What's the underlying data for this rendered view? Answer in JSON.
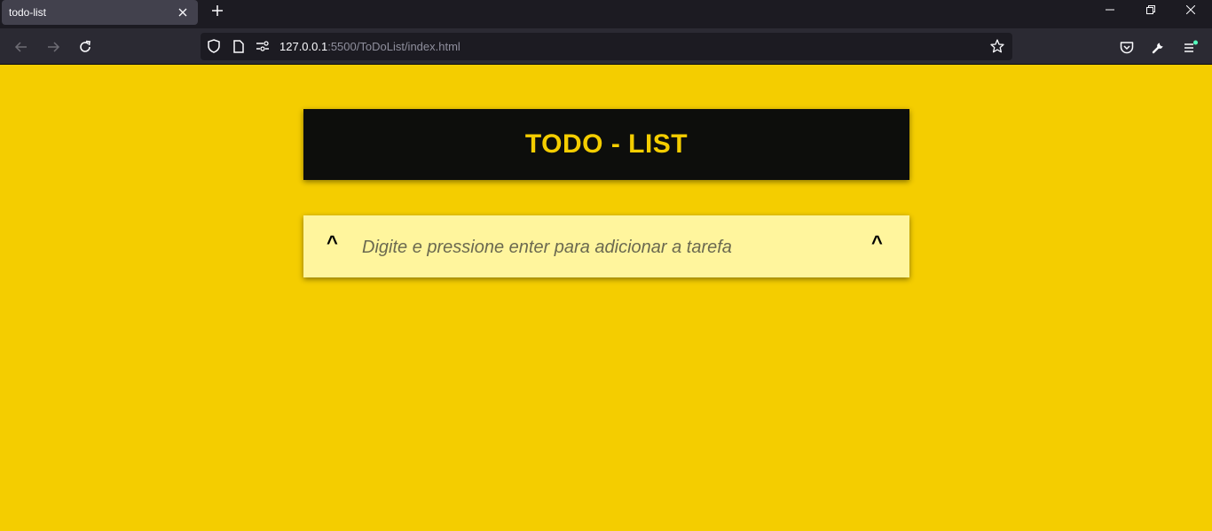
{
  "browser": {
    "tab_title": "todo-list",
    "url_host": "127.0.0.1",
    "url_rest": ":5500/ToDoList/index.html",
    "accent_color": "#54ffbd"
  },
  "app": {
    "title": "TODO - LIST",
    "input_placeholder": "Digite e pressione enter para adicionar a tarefa",
    "left_toggle": "^",
    "right_toggle": "^",
    "background_color": "#f4cd00",
    "header_bg": "#0d0e0c",
    "input_bg": "#fff59d"
  }
}
